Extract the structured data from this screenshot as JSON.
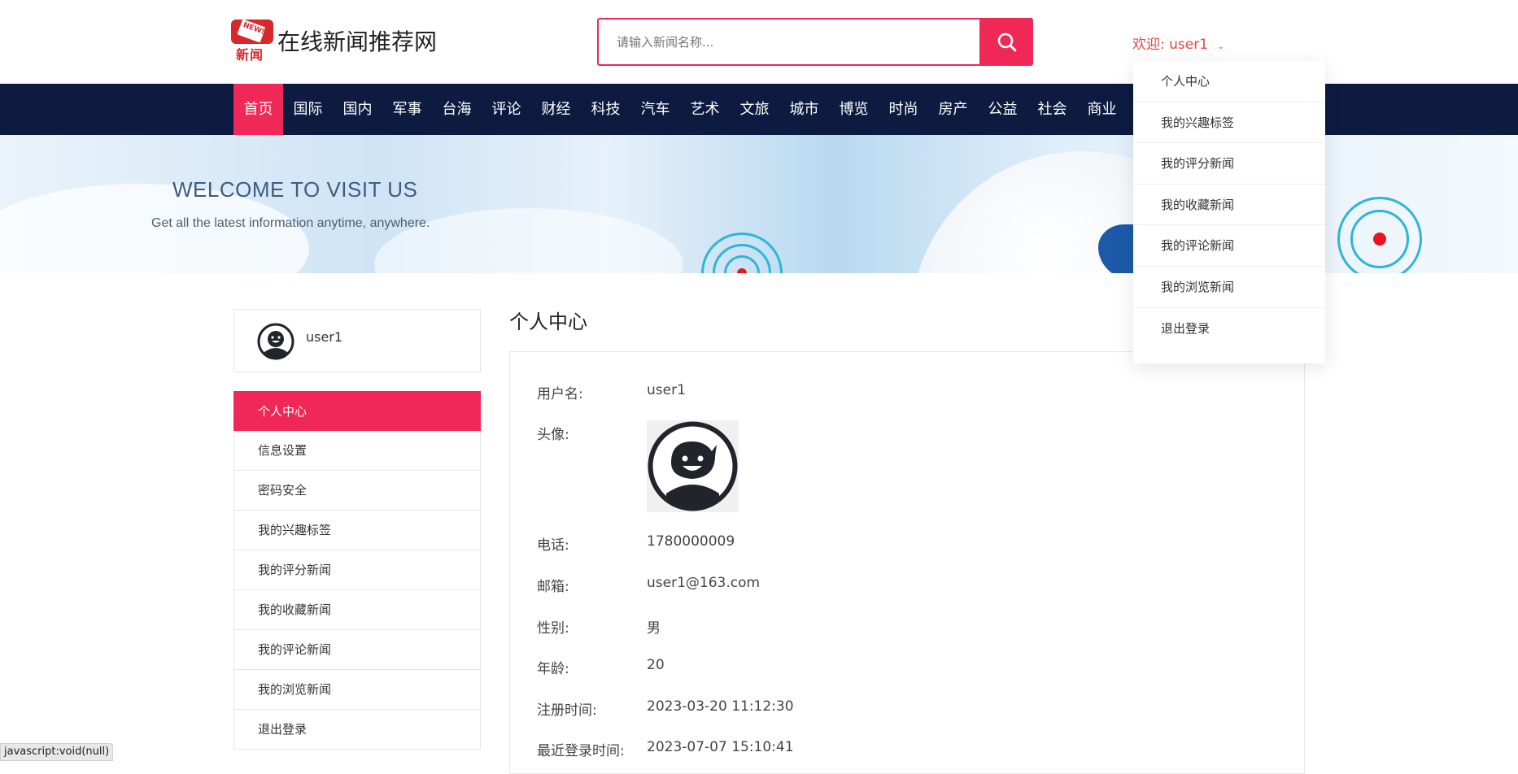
{
  "header": {
    "logo_text_top": "NEWS",
    "logo_text_cn": "新闻",
    "site_title": "在线新闻推荐网",
    "search_placeholder": "请输入新闻名称...",
    "welcome_prefix": "欢迎:",
    "welcome_user": "user1"
  },
  "nav": {
    "items": [
      "首页",
      "国际",
      "国内",
      "军事",
      "台海",
      "评论",
      "财经",
      "科技",
      "汽车",
      "艺术",
      "文旅",
      "城市",
      "博览",
      "时尚",
      "房产",
      "公益",
      "社会",
      "商业"
    ],
    "active_index": 0
  },
  "banner": {
    "title": "WELCOME TO VISIT US",
    "subtitle": "Get all the latest information anytime, anywhere."
  },
  "user_card": {
    "username": "user1"
  },
  "side_menu": {
    "items": [
      "个人中心",
      "信息设置",
      "密码安全",
      "我的兴趣标签",
      "我的评分新闻",
      "我的收藏新闻",
      "我的评论新闻",
      "我的浏览新闻",
      "退出登录"
    ],
    "active_index": 0
  },
  "profile": {
    "title": "个人中心",
    "fields": [
      {
        "label": "用户名:",
        "value": "user1"
      },
      {
        "label": "头像:",
        "value": ""
      },
      {
        "label": "电话:",
        "value": "1780000009"
      },
      {
        "label": "邮箱:",
        "value": "user1@163.com"
      },
      {
        "label": "性别:",
        "value": "男"
      },
      {
        "label": "年龄:",
        "value": "20"
      },
      {
        "label": "注册时间:",
        "value": "2023-03-20 11:12:30"
      },
      {
        "label": "最近登录时间:",
        "value": "2023-07-07 15:10:41"
      }
    ]
  },
  "dropdown": {
    "items": [
      "个人中心",
      "我的兴趣标签",
      "我的评分新闻",
      "我的收藏新闻",
      "我的评论新闻",
      "我的浏览新闻",
      "退出登录"
    ]
  },
  "status_bar": {
    "text": "javascript:void(null)"
  },
  "colors": {
    "accent": "#f02857",
    "nav_bg": "#0c1b3f",
    "welcome": "#e04a3e"
  },
  "icons": {
    "search": "search-icon",
    "chevron": "chevron-down-icon",
    "avatar": "avatar-face-icon"
  }
}
